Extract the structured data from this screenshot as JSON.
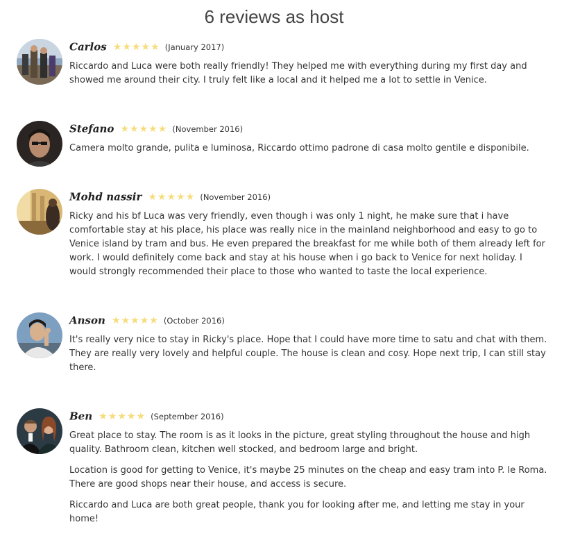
{
  "heading": "6 reviews as host",
  "colors": {
    "star": "#f6dc7a",
    "text": "#333333"
  },
  "reviews": [
    {
      "name": "Carlos",
      "rating": 5,
      "date": "(January 2017)",
      "paragraphs": [
        "Riccardo and Luca were both really friendly! They helped me with everything during my first day and showed me around their city. I truly felt like a local and it helped me a lot to settle in Venice."
      ]
    },
    {
      "name": "Stefano",
      "rating": 5,
      "date": "(November 2016)",
      "paragraphs": [
        "Camera molto grande, pulita e luminosa, Riccardo ottimo padrone di casa molto gentile e disponibile."
      ]
    },
    {
      "name": "Mohd nassir",
      "rating": 5,
      "date": "(November 2016)",
      "paragraphs": [
        "Ricky and his bf Luca was very friendly, even though i was only 1 night, he make sure that i have comfortable stay at his place, his place was really nice in the mainland neighborhood and easy to go to Venice island by tram and bus. He even prepared the breakfast for me while both of them already left for work. I would definitely come back and stay at his house when i go back to Venice for next holiday. I would strongly recommended their place to those who wanted to taste the local experience."
      ]
    },
    {
      "name": "Anson",
      "rating": 5,
      "date": "(October 2016)",
      "paragraphs": [
        "It's really very nice to stay in Ricky's place. Hope that I could have more time to satu and chat with them. They are really very lovely and helpful couple. The house is clean and cosy. Hope next trip, I can still stay there."
      ]
    },
    {
      "name": "Ben",
      "rating": 5,
      "date": "(September 2016)",
      "paragraphs": [
        "Great place to stay. The room is as it looks in the picture, great styling throughout the house and high quality. Bathroom clean, kitchen well stocked, and bedroom large and bright.",
        "Location is good for getting to Venice, it's maybe 25 minutes on the cheap and easy tram into P. le Roma. There are good shops near their house, and access is secure.",
        "Riccardo and Luca are both great people, thank you for looking after me, and letting me stay in your home!"
      ]
    }
  ]
}
